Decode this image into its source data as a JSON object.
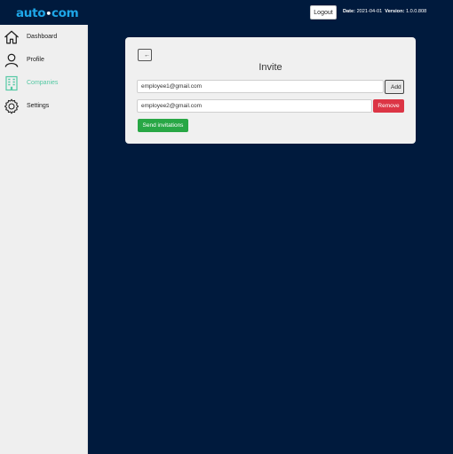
{
  "header": {
    "logo_left": "auto",
    "logo_separator": "•",
    "logo_right": "com",
    "logout_label": "Logout",
    "date_label": "Date:",
    "date_value": "2021-04-01",
    "version_label": "Version:",
    "version_value": "1.0.0.808"
  },
  "sidebar": {
    "items": [
      {
        "label": "Dashboard",
        "icon": "home-icon",
        "active": false
      },
      {
        "label": "Profile",
        "icon": "person-icon",
        "active": false
      },
      {
        "label": "Companies",
        "icon": "building-icon",
        "active": true
      },
      {
        "label": "Settings",
        "icon": "gear-icon",
        "active": false
      }
    ]
  },
  "invite": {
    "back_icon": "arrow-left-icon",
    "title": "Invite",
    "emails": [
      "employee1@gmail.com",
      "employee2@gmail.com"
    ],
    "add_label": "Add",
    "remove_label": "Remove",
    "send_label": "Send invitations"
  },
  "colors": {
    "background": "#001a3d",
    "logo": "#1ea7e8",
    "active_nav": "#55c9a4",
    "remove": "#dc3545",
    "send": "#28a745"
  }
}
